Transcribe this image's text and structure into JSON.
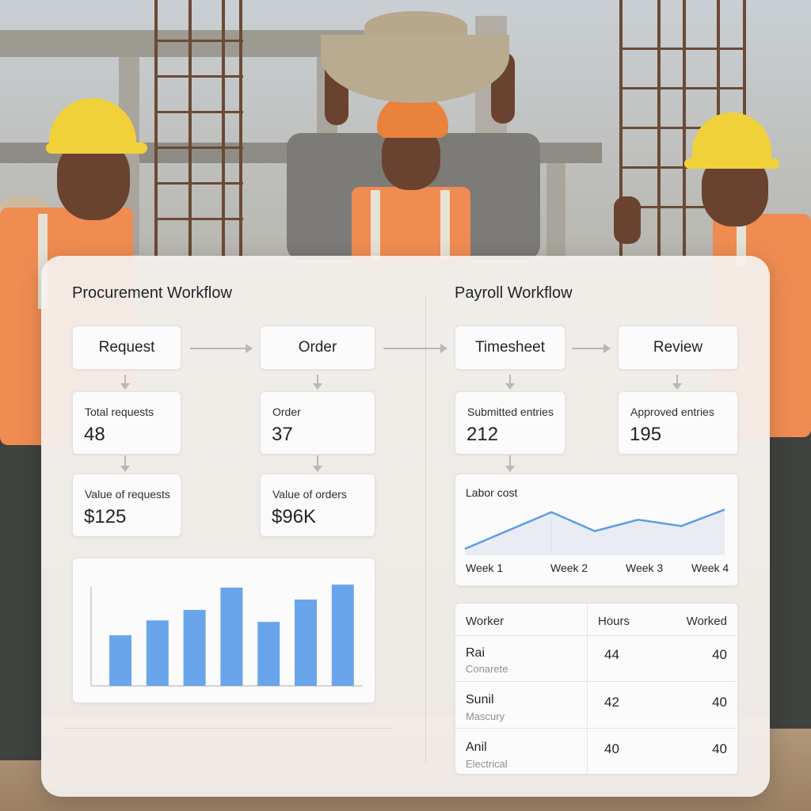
{
  "procurement": {
    "title": "Procurement Workflow",
    "steps": [
      "Request",
      "Order"
    ],
    "metrics": [
      {
        "label": "Total requests",
        "value": "48"
      },
      {
        "label": "Order",
        "value": "37"
      },
      {
        "label": "Value of requests",
        "value": "$125"
      },
      {
        "label": "Value of orders",
        "value": "$96K"
      }
    ]
  },
  "payroll": {
    "title": "Payroll Workflow",
    "steps": [
      "Timesheet",
      "Review"
    ],
    "metrics": [
      {
        "label": "Submitted entries",
        "value": "212"
      },
      {
        "label": "Approved entries",
        "value": "195"
      }
    ],
    "table": {
      "headers": [
        "Worker",
        "Hours",
        "Worked"
      ],
      "rows": [
        {
          "name": "Rai",
          "role": "Conarete",
          "hours": "44",
          "worked": "40"
        },
        {
          "name": "Sunil",
          "role": "Mascury",
          "hours": "42",
          "worked": "40"
        },
        {
          "name": "Anil",
          "role": "Electrical",
          "hours": "40",
          "worked": "40"
        }
      ]
    }
  },
  "colors": {
    "accent": "#5b9be8",
    "bar": "#6aa5ec",
    "area": "#e9edf3"
  },
  "chart_data": [
    {
      "type": "bar",
      "categories": [
        "",
        "",
        "",
        "",
        "",
        "",
        ""
      ],
      "values": [
        34,
        44,
        51,
        66,
        43,
        58,
        68
      ],
      "title": "",
      "xlabel": "",
      "ylabel": "",
      "ylim": [
        0,
        75
      ],
      "grid": false
    },
    {
      "type": "area",
      "title": "Labor cost",
      "categories": [
        "Week 1",
        "Week 2",
        "Week 3",
        "Week 4"
      ],
      "x": [
        0,
        1,
        1.5,
        2,
        2.5,
        3
      ],
      "values": [
        10,
        68,
        38,
        56,
        46,
        72
      ],
      "ylim": [
        0,
        100
      ],
      "grid": false
    }
  ]
}
